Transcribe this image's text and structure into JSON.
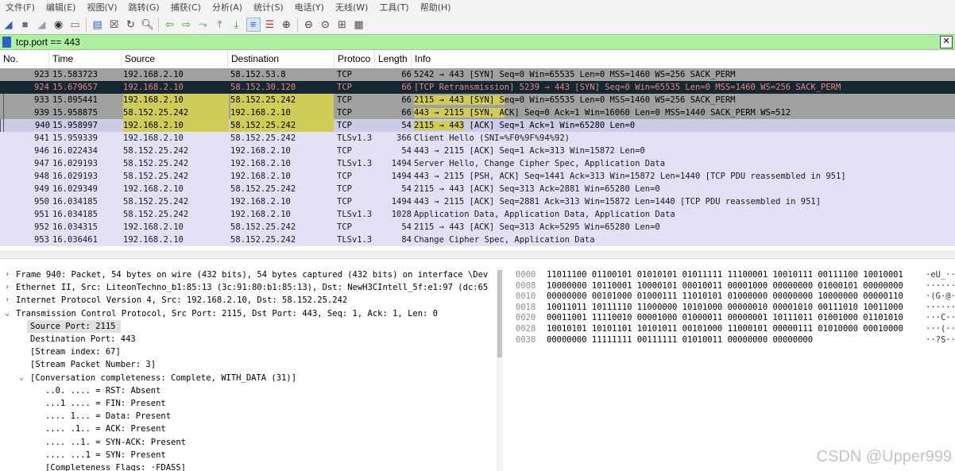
{
  "menu": [
    "文件(F)",
    "编辑(E)",
    "视图(V)",
    "跳转(G)",
    "捕获(C)",
    "分析(A)",
    "统计(S)",
    "电话(Y)",
    "无线(W)",
    "工具(T)",
    "帮助(H)"
  ],
  "toolbar_icons": [
    {
      "name": "shark-fin-start-icon",
      "glyph": "◢",
      "color": "#2b62c8"
    },
    {
      "name": "stop-square-icon",
      "glyph": "■",
      "color": "#707070"
    },
    {
      "name": "restart-fin-icon",
      "glyph": "◢",
      "color": "#9aa0a6"
    },
    {
      "name": "options-gear-icon",
      "glyph": "◉",
      "color": "#303030"
    },
    {
      "name": "open-file-icon",
      "glyph": "▭",
      "color": "#707070"
    },
    {
      "name": "save-file-icon",
      "glyph": "▤",
      "color": "#2b62c8"
    },
    {
      "name": "close-file-icon",
      "glyph": "☒",
      "color": "#404040"
    },
    {
      "name": "reload-icon",
      "glyph": "↻",
      "color": "#404040"
    },
    {
      "name": "find-packet-icon",
      "glyph": "🔍︎",
      "color": "#303030"
    },
    {
      "name": "go-back-icon",
      "glyph": "⇦",
      "color": "#3a9a3a"
    },
    {
      "name": "go-forward-icon",
      "glyph": "⇨",
      "color": "#3a9a3a"
    },
    {
      "name": "go-to-packet-icon",
      "glyph": "⤳",
      "color": "#3a9a3a"
    },
    {
      "name": "go-first-icon",
      "glyph": "⤒",
      "color": "#3a9a3a"
    },
    {
      "name": "go-last-icon",
      "glyph": "⤓",
      "color": "#3a9a3a"
    },
    {
      "name": "auto-scroll-icon",
      "glyph": "≡",
      "color": "#2b62c8"
    },
    {
      "name": "colorize-icon",
      "glyph": "☰",
      "color": "#b03030"
    },
    {
      "name": "zoom-in-icon",
      "glyph": "⊕",
      "color": "#303030"
    },
    {
      "name": "zoom-out-icon",
      "glyph": "⊖",
      "color": "#303030"
    },
    {
      "name": "zoom-normal-icon",
      "glyph": "⊙",
      "color": "#303030"
    },
    {
      "name": "resize-columns-icon",
      "glyph": "⊞",
      "color": "#505050"
    },
    {
      "name": "column-grid-icon",
      "glyph": "▦",
      "color": "#505050"
    }
  ],
  "filter": {
    "value": "tcp.port == 443"
  },
  "columns": [
    "No.",
    "Time",
    "Source",
    "Destination",
    "Protoco",
    "Length",
    "Info"
  ],
  "packets": [
    {
      "no": "923",
      "time": "15.583723",
      "src": "192.168.2.10",
      "dst": "58.152.53.8",
      "proto": "TCP",
      "len": "66",
      "info": "5242 → 443 [SYN] Seq=0 Win=65535 Len=0 MSS=1460 WS=256 SACK_PERM"
    },
    {
      "no": "924",
      "time": "15.679657",
      "src": "192.168.2.10",
      "dst": "58.152.30.120",
      "proto": "TCP",
      "len": "66",
      "info": "[TCP Retransmission] 5239 → 443 [SYN] Seq=0 Win=65535 Len=0 MSS=1460 WS=256 SACK_PERM"
    },
    {
      "no": "933",
      "time": "15.895441",
      "src": "192.168.2.10",
      "dst": "58.152.25.242",
      "proto": "TCP",
      "len": "66",
      "info": "2115 → 443 [SYN] Seq=0 Win=65535 Len=0 MSS=1460 WS=256 SACK_PERM"
    },
    {
      "no": "939",
      "time": "15.958875",
      "src": "58.152.25.242",
      "dst": "192.168.2.10",
      "proto": "TCP",
      "len": "66",
      "info": "443 → 2115 [SYN, ACK] Seq=0 Ack=1 Win=16060 Len=0 MSS=1440 SACK_PERM WS=512"
    },
    {
      "no": "940",
      "time": "15.958997",
      "src": "192.168.2.10",
      "dst": "58.152.25.242",
      "proto": "TCP",
      "len": "54",
      "info": "2115 → 443 [ACK] Seq=1 Ack=1 Win=65280 Len=0"
    },
    {
      "no": "941",
      "time": "15.959339",
      "src": "192.168.2.10",
      "dst": "58.152.25.242",
      "proto": "TLSv1.3",
      "len": "366",
      "info": "Client Hello (SNI=%F0%9F%94%92)"
    },
    {
      "no": "946",
      "time": "16.022434",
      "src": "58.152.25.242",
      "dst": "192.168.2.10",
      "proto": "TCP",
      "len": "54",
      "info": "443 → 2115 [ACK] Seq=1 Ack=313 Win=15872 Len=0"
    },
    {
      "no": "947",
      "time": "16.029193",
      "src": "58.152.25.242",
      "dst": "192.168.2.10",
      "proto": "TLSv1.3",
      "len": "1494",
      "info": "Server Hello, Change Cipher Spec, Application Data"
    },
    {
      "no": "948",
      "time": "16.029193",
      "src": "58.152.25.242",
      "dst": "192.168.2.10",
      "proto": "TCP",
      "len": "1494",
      "info": "443 → 2115 [PSH, ACK] Seq=1441 Ack=313 Win=15872 Len=1440 [TCP PDU reassembled in 951]"
    },
    {
      "no": "949",
      "time": "16.029349",
      "src": "192.168.2.10",
      "dst": "58.152.25.242",
      "proto": "TCP",
      "len": "54",
      "info": "2115 → 443 [ACK] Seq=313 Ack=2881 Win=65280 Len=0"
    },
    {
      "no": "950",
      "time": "16.034185",
      "src": "58.152.25.242",
      "dst": "192.168.2.10",
      "proto": "TCP",
      "len": "1494",
      "info": "443 → 2115 [ACK] Seq=2881 Ack=313 Win=15872 Len=1440 [TCP PDU reassembled in 951]"
    },
    {
      "no": "951",
      "time": "16.034185",
      "src": "58.152.25.242",
      "dst": "192.168.2.10",
      "proto": "TLSv1.3",
      "len": "1028",
      "info": "Application Data, Application Data, Application Data"
    },
    {
      "no": "952",
      "time": "16.034315",
      "src": "192.168.2.10",
      "dst": "58.152.25.242",
      "proto": "TCP",
      "len": "54",
      "info": "2115 → 443 [ACK] Seq=313 Ack=5295 Win=65280 Len=0"
    },
    {
      "no": "953",
      "time": "16.036461",
      "src": "192.168.2.10",
      "dst": "58.152.25.242",
      "proto": "TLSv1.3",
      "len": "84",
      "info": "Change Cipher Spec, Application Data"
    }
  ],
  "details": [
    {
      "toggle": "›",
      "text": "Frame 940: Packet, 54 bytes on wire (432 bits), 54 bytes captured (432 bits) on interface \\Dev"
    },
    {
      "toggle": "›",
      "text": "Ethernet II, Src: LiteonTechno_b1:85:13 (3c:91:80:b1:85:13), Dst: NewH3CIntell_5f:e1:97 (dc:65"
    },
    {
      "toggle": "›",
      "text": "Internet Protocol Version 4, Src: 192.168.2.10, Dst: 58.152.25.242"
    },
    {
      "toggle": "⌄",
      "text": "Transmission Control Protocol, Src Port: 2115, Dst Port: 443, Seq: 1, Ack: 1, Len: 0"
    },
    {
      "toggle": "",
      "text": "Source Port: 2115"
    },
    {
      "toggle": "",
      "text": "Destination Port: 443"
    },
    {
      "toggle": "",
      "text": "[Stream index: 67]"
    },
    {
      "toggle": "",
      "text": "[Stream Packet Number: 3]"
    },
    {
      "toggle": "⌄",
      "text": "[Conversation completeness: Complete, WITH_DATA (31)]"
    },
    {
      "toggle": "",
      "text": "..0. .... = RST: Absent"
    },
    {
      "toggle": "",
      "text": "...1 .... = FIN: Present"
    },
    {
      "toggle": "",
      "text": ".... 1... = Data: Present"
    },
    {
      "toggle": "",
      "text": ".... .1.. = ACK: Present"
    },
    {
      "toggle": "",
      "text": ".... ..1. = SYN-ACK: Present"
    },
    {
      "toggle": "",
      "text": ".... ...1 = SYN: Present"
    },
    {
      "toggle": "",
      "text": "[Completeness Flags: ·FDASS]"
    }
  ],
  "bytes": [
    {
      "off": "0000",
      "hex": "11011100 01100101 01010101 01011111 11100001 10010111 00111100 10010001",
      "ascii": "·eU_··"
    },
    {
      "off": "0008",
      "hex": "10000000 10110001 10000101 00010011 00001000 00000000 01000101 00000000",
      "ascii": "······"
    },
    {
      "off": "0010",
      "hex": "00000000 00101000 01000111 11010101 01000000 00000000 10000000 00000110",
      "ascii": "·(G·@·"
    },
    {
      "off": "0018",
      "hex": "10011011 10111110 11000000 10101000 00000010 00001010 00111010 10011000",
      "ascii": "······"
    },
    {
      "off": "0020",
      "hex": "00011001 11110010 00001000 01000011 00000001 10111011 01001000 01101010",
      "ascii": "···C··"
    },
    {
      "off": "0028",
      "hex": "10010101 10101101 10101011 00101000 11000101 00000111 01010000 00010000",
      "ascii": "···(··"
    },
    {
      "off": "0030",
      "hex": "00000000 11111111 00111111 01010011 00000000 00000000",
      "ascii": "··?S··"
    }
  ],
  "watermark": "CSDN @Upper999"
}
